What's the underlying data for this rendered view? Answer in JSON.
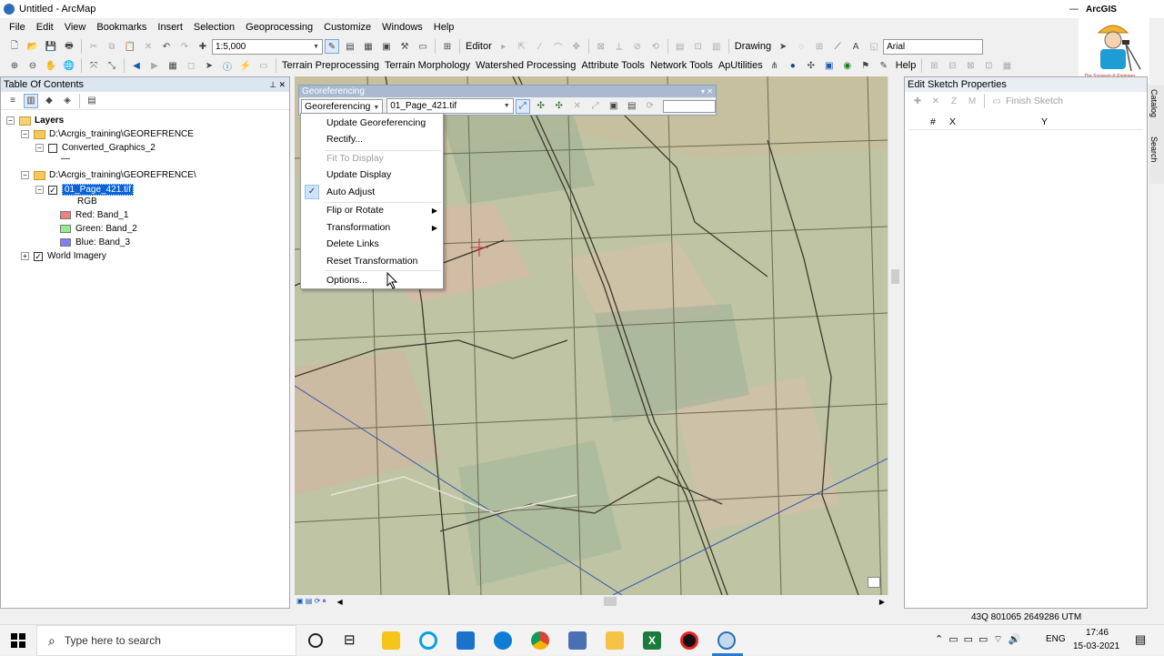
{
  "window": {
    "title": "Untitled - ArcMap",
    "minimize": "—",
    "maximize": "☐",
    "close": "✕"
  },
  "menu": [
    "File",
    "Edit",
    "View",
    "Bookmarks",
    "Insert",
    "Selection",
    "Geoprocessing",
    "Customize",
    "Windows",
    "Help"
  ],
  "logo": {
    "brand": "ArcGIS",
    "tagline": "The Surveyor & Engineer"
  },
  "toolbar1": {
    "scale": "1:5,000",
    "editor": "Editor",
    "drawing": "Drawing",
    "font": "Arial"
  },
  "toolbar2": {
    "items": [
      "Terrain Preprocessing",
      "Terrain Morphology",
      "Watershed Processing",
      "Attribute Tools",
      "Network Tools",
      "ApUtilities"
    ],
    "help": "Help"
  },
  "toc": {
    "title": "Table Of Contents",
    "layers": "Layers",
    "folder1": "D:\\Acrgis_training\\GEOREFRENCE",
    "converted": "Converted_Graphics_2",
    "dash": "—",
    "folder2": "D:\\Acrgis_training\\GEOREFRENCE\\",
    "raster": "01_Page_421.tif",
    "rgb": "RGB",
    "red": "Red:    Band_1",
    "green": "Green: Band_2",
    "blue": "Blue:   Band_3",
    "world": "World Imagery",
    "colors": {
      "red": "#f08080",
      "green": "#90ee90",
      "blue": "#8080f0"
    }
  },
  "georef": {
    "title": "Georeferencing",
    "button": "Georeferencing",
    "layer": "01_Page_421.tif"
  },
  "georef_menu": {
    "items": [
      "Update Georeferencing",
      "Rectify...",
      "Fit To Display",
      "Update Display",
      "Auto Adjust",
      "Flip or Rotate",
      "Transformation",
      "Delete Links",
      "Reset Transformation",
      "Options..."
    ],
    "checked": "Auto Adjust",
    "disabled": "Fit To Display"
  },
  "sketch": {
    "title": "Edit Sketch Properties",
    "finish": "Finish Sketch",
    "col_hash": "#",
    "col_x": "X",
    "col_y": "Y"
  },
  "side_tabs": [
    "Catalog",
    "Search"
  ],
  "status": {
    "coords": "43Q 801065 2649286 UTM"
  },
  "taskbar": {
    "search": "Type here to search",
    "lang": "ENG",
    "time": "17:46",
    "date": "15-03-2021"
  }
}
